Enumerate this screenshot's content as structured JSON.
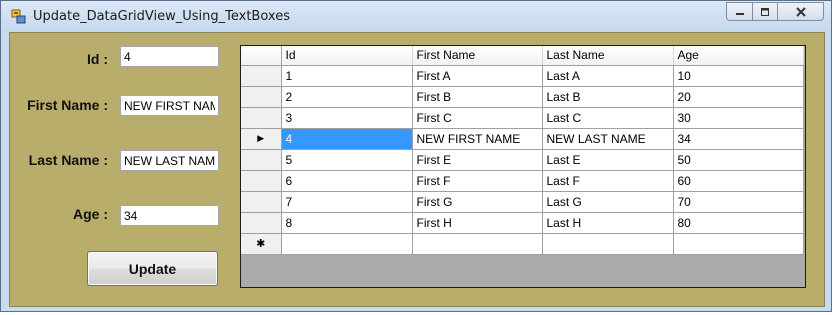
{
  "window": {
    "title": "Update_DataGridView_Using_TextBoxes"
  },
  "form": {
    "id_label": "Id :",
    "id_value": "4",
    "first_name_label": "First Name :",
    "first_name_value": "NEW FIRST NAME",
    "last_name_label": "Last Name :",
    "last_name_value": "NEW LAST NAME",
    "age_label": "Age :",
    "age_value": "34",
    "update_label": "Update"
  },
  "grid": {
    "columns": [
      "Id",
      "First Name",
      "Last Name",
      "Age"
    ],
    "rows": [
      [
        "1",
        "First A",
        "Last A",
        "10"
      ],
      [
        "2",
        "First B",
        "Last B",
        "20"
      ],
      [
        "3",
        "First C",
        "Last C",
        "30"
      ],
      [
        "4",
        "NEW FIRST NAME",
        "NEW LAST NAME",
        "34"
      ],
      [
        "5",
        "First E",
        "Last E",
        "50"
      ],
      [
        "6",
        "First F",
        "Last F",
        "60"
      ],
      [
        "7",
        "First G",
        "Last G",
        "70"
      ],
      [
        "8",
        "First H",
        "Last H",
        "80"
      ]
    ],
    "current_row_marker": "▶",
    "new_row_marker": "✱"
  },
  "colors": {
    "form_background": "#b9ad6b",
    "selection": "#3399ff",
    "window_frame": "#c9dcef"
  },
  "icons": [
    "app-icon",
    "minimize-icon",
    "maximize-icon",
    "close-icon"
  ]
}
